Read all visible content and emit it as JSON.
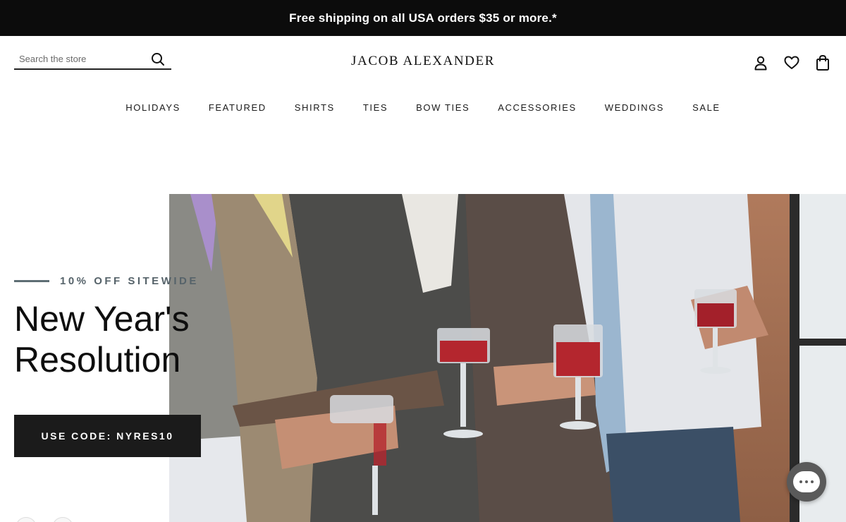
{
  "announcement": {
    "text": "Free shipping on all USA orders $35 or more.*"
  },
  "search": {
    "placeholder": "Search the store",
    "icon": "search-icon"
  },
  "brand": {
    "logo_text": "JACOB ALEXANDER"
  },
  "header_icons": [
    "account-icon",
    "heart-icon",
    "bag-icon"
  ],
  "nav": {
    "items": [
      {
        "label": "HOLIDAYS"
      },
      {
        "label": "FEATURED"
      },
      {
        "label": "SHIRTS"
      },
      {
        "label": "TIES"
      },
      {
        "label": "BOW TIES"
      },
      {
        "label": "ACCESSORIES"
      },
      {
        "label": "WEDDINGS"
      },
      {
        "label": "SALE"
      }
    ]
  },
  "hero": {
    "tagline": "10% OFF SITEWIDE",
    "headline_line1": "New Year's",
    "headline_line2": "Resolution",
    "cta_label": "USE CODE: NYRES10"
  },
  "chat": {
    "icon": "chat-bubble-icon"
  },
  "colors": {
    "announcement_bg": "#0c0c0c",
    "cta_bg": "#1b1b1b",
    "tagline": "#56636a",
    "chat_bg": "#5a5a5a"
  }
}
